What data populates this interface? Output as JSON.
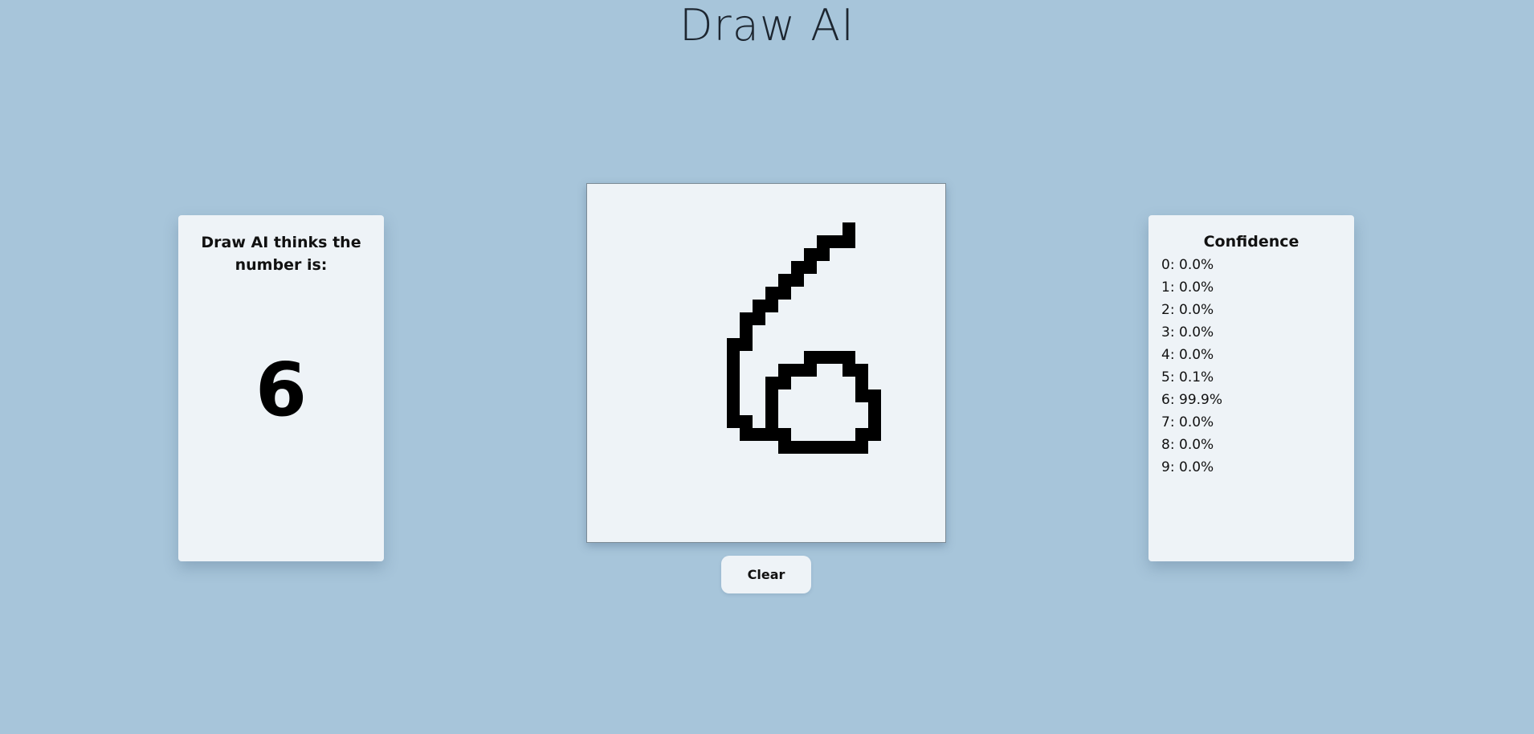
{
  "app": {
    "title": "Draw AI"
  },
  "prediction": {
    "heading": "Draw AI thinks the number is:",
    "value": "6"
  },
  "canvas": {
    "background": "#eef3f7",
    "ink": "#000000"
  },
  "actions": {
    "clear_label": "Clear"
  },
  "confidence": {
    "heading": "Confidence",
    "rows": [
      {
        "digit": "0:",
        "value": "0.0%"
      },
      {
        "digit": "1:",
        "value": "0.0%"
      },
      {
        "digit": "2:",
        "value": "0.0%"
      },
      {
        "digit": "3:",
        "value": "0.0%"
      },
      {
        "digit": "4:",
        "value": "0.0%"
      },
      {
        "digit": "5:",
        "value": "0.1%"
      },
      {
        "digit": "6:",
        "value": "99.9%"
      },
      {
        "digit": "7:",
        "value": "0.0%"
      },
      {
        "digit": "8:",
        "value": "0.0%"
      },
      {
        "digit": "9:",
        "value": "0.0%"
      }
    ]
  },
  "colors": {
    "page_background": "#a7c5da",
    "card_background": "#eef3f7"
  }
}
